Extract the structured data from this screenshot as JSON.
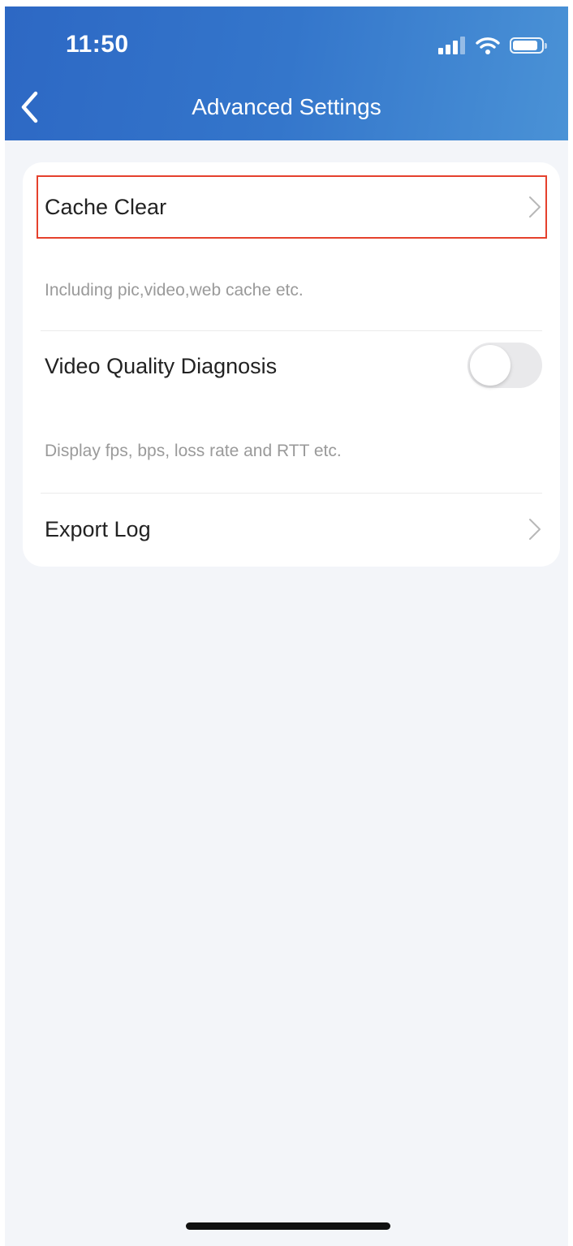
{
  "status_bar": {
    "time": "11:50",
    "icons": [
      "signal-icon",
      "wifi-icon",
      "battery-icon"
    ]
  },
  "nav": {
    "back_icon": "chevron-left-icon",
    "title": "Advanced Settings"
  },
  "settings": {
    "cache_clear": {
      "label": "Cache Clear",
      "description": "Including pic,video,web cache etc.",
      "highlighted": true
    },
    "video_quality": {
      "label": "Video Quality Diagnosis",
      "description": "Display fps, bps, loss rate and RTT etc.",
      "enabled": false
    },
    "export_log": {
      "label": "Export Log"
    }
  },
  "colors": {
    "header_start": "#2d68c4",
    "header_end": "#4a92d6",
    "background": "#f3f5f9",
    "highlight": "#e5412d",
    "toggle_off": "#e9e9eb"
  }
}
